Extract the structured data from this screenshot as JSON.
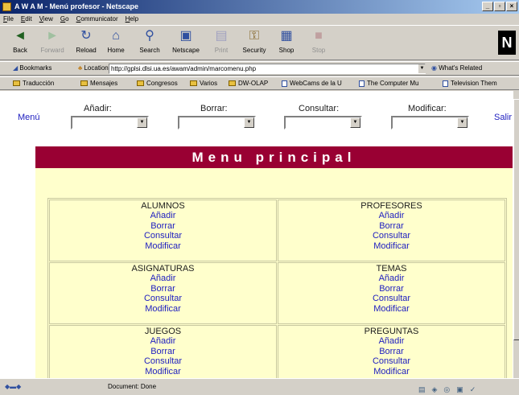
{
  "window": {
    "title": "A W A M - Menú profesor - Netscape",
    "controls": [
      "_",
      "▫",
      "×"
    ]
  },
  "menubar": [
    "File",
    "Edit",
    "View",
    "Go",
    "Communicator",
    "Help"
  ],
  "nav_toolbar": [
    {
      "label": "Back",
      "icon": "back-arrow-icon",
      "glyph": "◄",
      "enabled": true
    },
    {
      "label": "Forward",
      "icon": "forward-arrow-icon",
      "glyph": "►",
      "enabled": false
    },
    {
      "label": "Reload",
      "icon": "reload-icon",
      "glyph": "↻",
      "enabled": true
    },
    {
      "label": "Home",
      "icon": "home-icon",
      "glyph": "⌂",
      "enabled": true
    },
    {
      "label": "Search",
      "icon": "search-icon",
      "glyph": "⚲",
      "enabled": true
    },
    {
      "label": "Netscape",
      "icon": "netscape-icon",
      "glyph": "▣",
      "enabled": true
    },
    {
      "label": "Print",
      "icon": "print-icon",
      "glyph": "▤",
      "enabled": false
    },
    {
      "label": "Security",
      "icon": "lock-icon",
      "glyph": "🔒",
      "enabled": true
    },
    {
      "label": "Shop",
      "icon": "shop-icon",
      "glyph": "▦",
      "enabled": true
    },
    {
      "label": "Stop",
      "icon": "stop-icon",
      "glyph": "■",
      "enabled": false
    }
  ],
  "location_bar": {
    "bookmarks_label": "Bookmarks",
    "location_label": "Location:",
    "url": "http://gplsi.dlsi.ua.es/awam/admin/marcomenu.php",
    "related_label": "What's Related"
  },
  "personal_toolbar": [
    {
      "label": "Traducción",
      "icon": "folder-icon"
    },
    {
      "label": "Mensajes",
      "icon": "folder-icon"
    },
    {
      "label": "Congresos",
      "icon": "folder-icon"
    },
    {
      "label": "Varios",
      "icon": "folder-icon"
    },
    {
      "label": "DW-OLAP",
      "icon": "folder-icon"
    },
    {
      "label": "WebCams de la U",
      "icon": "page-icon"
    },
    {
      "label": "The Computer Mu",
      "icon": "page-icon"
    },
    {
      "label": "Television Them",
      "icon": "page-icon"
    }
  ],
  "page": {
    "menu_link": "Menú",
    "salir_link": "Salir",
    "dropdowns": [
      {
        "label": "Añadir:",
        "value": ""
      },
      {
        "label": "Borrar:",
        "value": ""
      },
      {
        "label": "Consultar:",
        "value": ""
      },
      {
        "label": "Modificar:",
        "value": ""
      }
    ],
    "banner_title": "Menu principal",
    "sections": [
      {
        "title": "ALUMNOS",
        "links": [
          "Añadir",
          "Borrar",
          "Consultar",
          "Modificar"
        ]
      },
      {
        "title": "PROFESORES",
        "links": [
          "Añadir",
          "Borrar",
          "Consultar",
          "Modificar"
        ]
      },
      {
        "title": "ASIGNATURAS",
        "links": [
          "Añadir",
          "Borrar",
          "Consultar",
          "Modificar"
        ]
      },
      {
        "title": "TEMAS",
        "links": [
          "Añadir",
          "Borrar",
          "Consultar",
          "Modificar"
        ]
      },
      {
        "title": "JUEGOS",
        "links": [
          "Añadir",
          "Borrar",
          "Consultar",
          "Modificar"
        ]
      },
      {
        "title": "PREGUNTAS",
        "links": [
          "Añadir",
          "Borrar",
          "Consultar",
          "Modificar"
        ]
      }
    ]
  },
  "status": {
    "text": "Document: Done"
  },
  "colors": {
    "banner": "#990033",
    "panel_bg": "#ffffcc",
    "link": "#2020c0"
  }
}
